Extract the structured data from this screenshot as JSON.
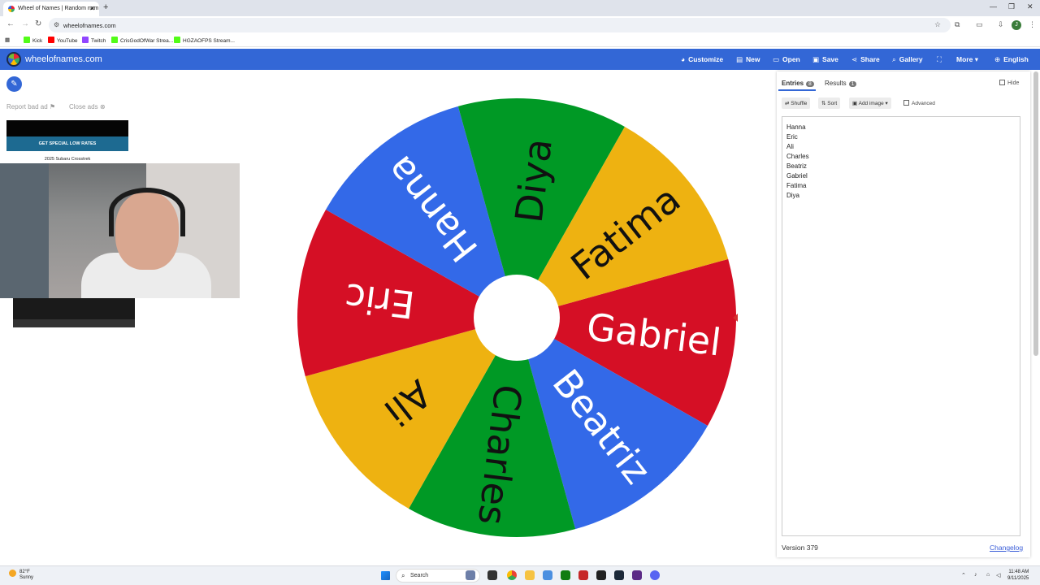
{
  "browser": {
    "tab_title": "Wheel of Names | Random nam",
    "new_tab": "+",
    "url": "wheelofnames.com",
    "bookmarks": [
      "Kick",
      "YouTube",
      "Twitch",
      "CrisGodOfWar Strea...",
      "HGZAOFPS Stream..."
    ],
    "bookmark_colors": [
      "#53fc18",
      "#ff0000",
      "#9146ff",
      "#53fc18",
      "#53fc18"
    ]
  },
  "app": {
    "brand": "wheelofnames.com",
    "menu": [
      {
        "label": "Customize",
        "icon": "palette-icon",
        "glyph": "◕"
      },
      {
        "label": "New",
        "icon": "new-file-icon",
        "glyph": "▤"
      },
      {
        "label": "Open",
        "icon": "folder-icon",
        "glyph": "▭"
      },
      {
        "label": "Save",
        "icon": "save-icon",
        "glyph": "▣"
      },
      {
        "label": "Share",
        "icon": "share-icon",
        "glyph": "⋖"
      },
      {
        "label": "Gallery",
        "icon": "search-icon",
        "glyph": "⌕"
      },
      {
        "label": "",
        "icon": "fullscreen-icon",
        "glyph": "⛶"
      },
      {
        "label": "More",
        "icon": "chevron-down-icon",
        "glyph": "▾"
      },
      {
        "label": "English",
        "icon": "globe-icon",
        "glyph": "⊕"
      }
    ]
  },
  "ads": {
    "report_bad_ad": "Report bad ad",
    "close_ads": "Close ads",
    "button": "GET SPECIAL LOW RATES",
    "caption": "2025 Subaru Crosstrek"
  },
  "wheel": {
    "colors": {
      "blue": "#3369e8",
      "green": "#009925",
      "yellow": "#eeb211",
      "red": "#d50f25"
    },
    "segments": [
      {
        "label": "Gabriel",
        "color": "#d50f25"
      },
      {
        "label": "Beatriz",
        "color": "#3369e8"
      },
      {
        "label": "Charles",
        "color": "#009925"
      },
      {
        "label": "Ali",
        "color": "#eeb211"
      },
      {
        "label": "Eric",
        "color": "#d50f25"
      },
      {
        "label": "Hanna",
        "color": "#3369e8"
      },
      {
        "label": "Diya",
        "color": "#009925"
      },
      {
        "label": "Fatima",
        "color": "#eeb211"
      }
    ]
  },
  "panel": {
    "tab_entries": "Entries",
    "entries_count": "8",
    "tab_results": "Results",
    "results_count": "1",
    "hide": "Hide",
    "shuffle": "Shuffle",
    "sort": "Sort",
    "add_image": "Add image",
    "advanced": "Advanced",
    "entries": [
      "Hanna",
      "Eric",
      "Ali",
      "Charles",
      "Beatriz",
      "Gabriel",
      "Fatima",
      "Diya"
    ],
    "version": "Version 379",
    "changelog": "Changelog"
  },
  "taskbar": {
    "temp": "82°F",
    "weather": "Sunny",
    "search": "Search",
    "time": "11:48 AM",
    "date": "9/11/2025",
    "weather_color": "#f4a623"
  }
}
